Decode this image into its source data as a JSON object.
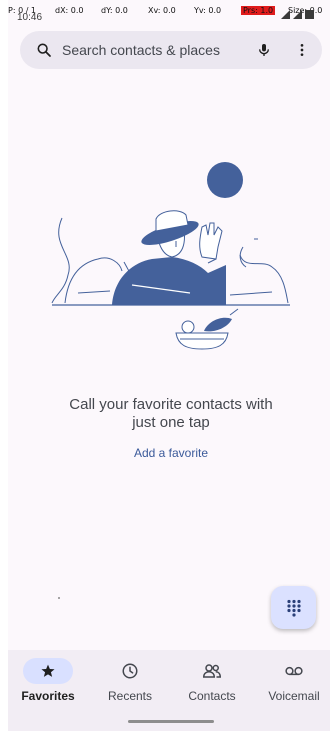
{
  "debug": {
    "pointer": "P: 0 / 1",
    "dx": "dX: 0.0",
    "dy": "dY: 0.0",
    "xv": "Xv: 0.0",
    "yv": "Yv: 0.0",
    "prs": "Prs: 1.0",
    "size": "Size: 0.0"
  },
  "status_bar": {
    "time": "10:46"
  },
  "search": {
    "placeholder": "Search contacts & places"
  },
  "empty_state": {
    "title": "Call your favorite contacts with just one tap",
    "action": "Add a favorite"
  },
  "bottom_nav": {
    "items": [
      {
        "label": "Favorites",
        "icon": "star-icon",
        "active": true
      },
      {
        "label": "Recents",
        "icon": "clock-icon",
        "active": false
      },
      {
        "label": "Contacts",
        "icon": "people-icon",
        "active": false
      },
      {
        "label": "Voicemail",
        "icon": "voicemail-icon",
        "active": false
      }
    ]
  },
  "colors": {
    "accent": "#3b5a9a",
    "illustration": "#44619b",
    "search_bg": "#ebe7f0",
    "nav_bg": "#f2edf4",
    "active_pill": "#d9e0ff"
  }
}
